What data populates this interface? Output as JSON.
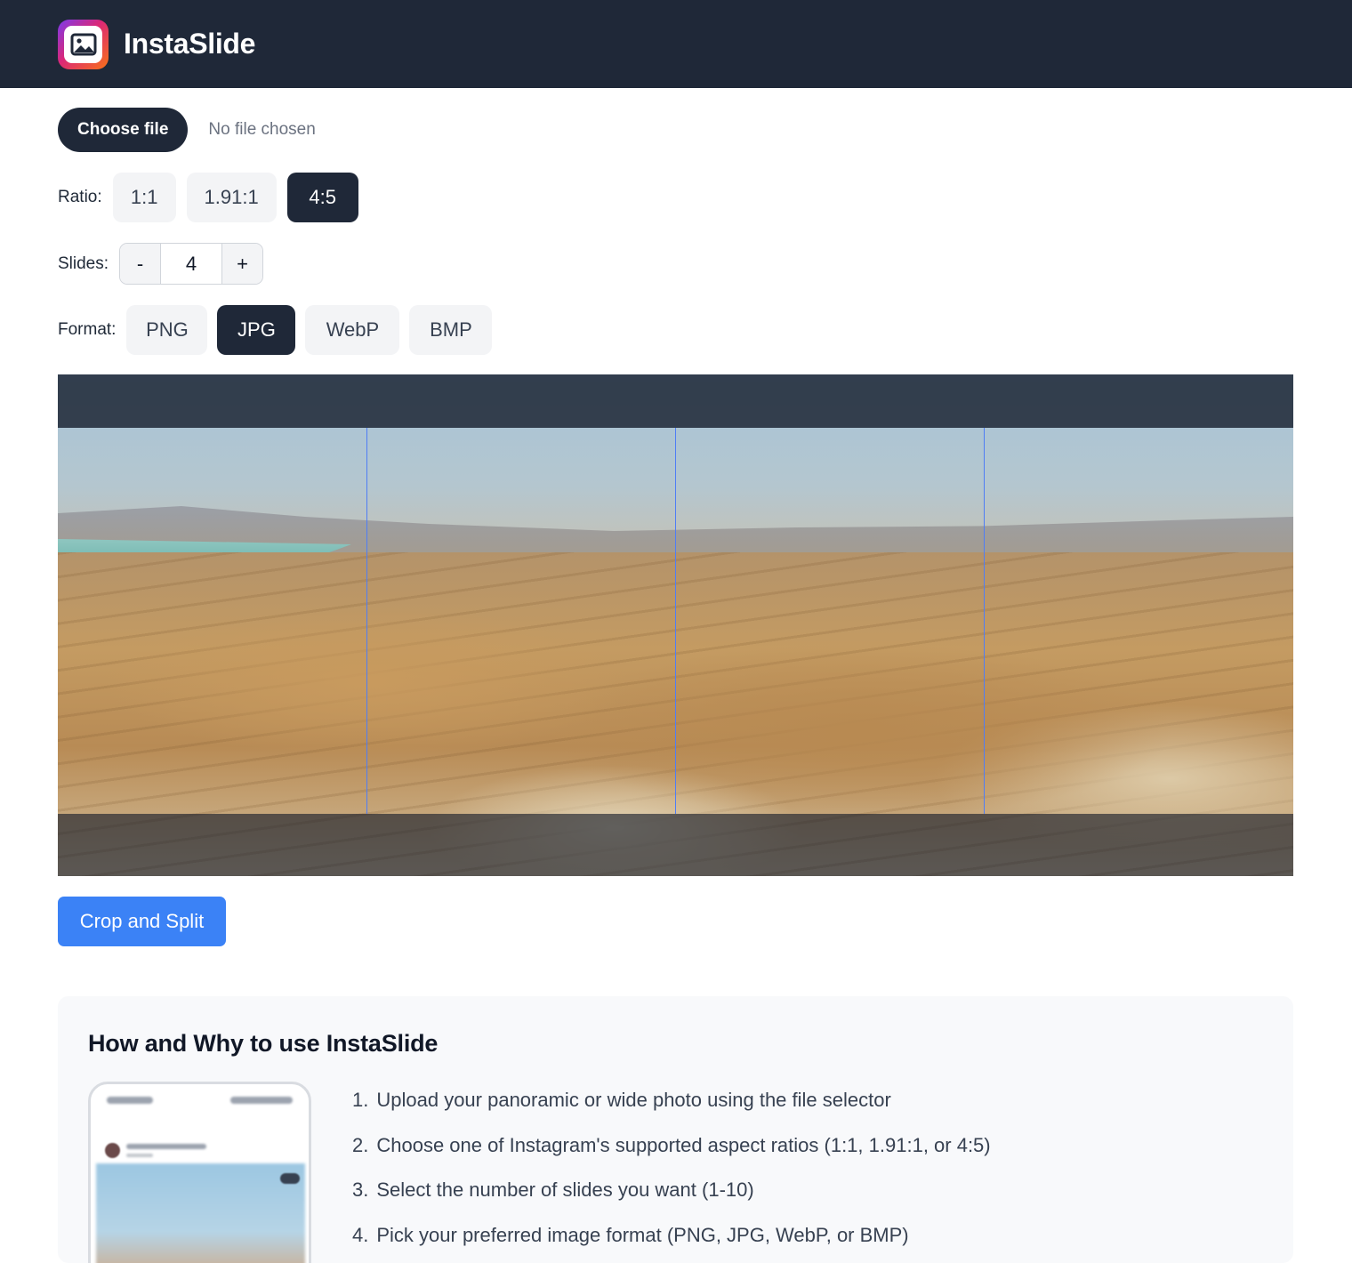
{
  "app": {
    "title": "InstaSlide",
    "logo_icon": "image-icon"
  },
  "file": {
    "button_label": "Choose file",
    "status": "No file chosen"
  },
  "ratio": {
    "label": "Ratio:",
    "options": [
      "1:1",
      "1.91:1",
      "4:5"
    ],
    "selected": "4:5"
  },
  "slides": {
    "label": "Slides:",
    "minus": "-",
    "value": "4",
    "plus": "+"
  },
  "format": {
    "label": "Format:",
    "options": [
      "PNG",
      "JPG",
      "WebP",
      "BMP"
    ],
    "selected": "JPG"
  },
  "preview": {
    "slide_count": 4,
    "image": "desert panorama"
  },
  "actions": {
    "crop_label": "Crop and Split"
  },
  "info": {
    "title": "How and Why to use InstaSlide",
    "steps": [
      {
        "num": "1.",
        "text": "Upload your panoramic or wide photo using the file selector"
      },
      {
        "num": "2.",
        "text": "Choose one of Instagram's supported aspect ratios (1:1, 1.91:1, or 4:5)"
      },
      {
        "num": "3.",
        "text": "Select the number of slides you want (1-10)"
      },
      {
        "num": "4.",
        "text": "Pick your preferred image format (PNG, JPG, WebP, or BMP)"
      }
    ]
  },
  "colors": {
    "header_bg": "#1f2838",
    "accent": "#3b82f6",
    "split_line": "#4f7df5"
  }
}
